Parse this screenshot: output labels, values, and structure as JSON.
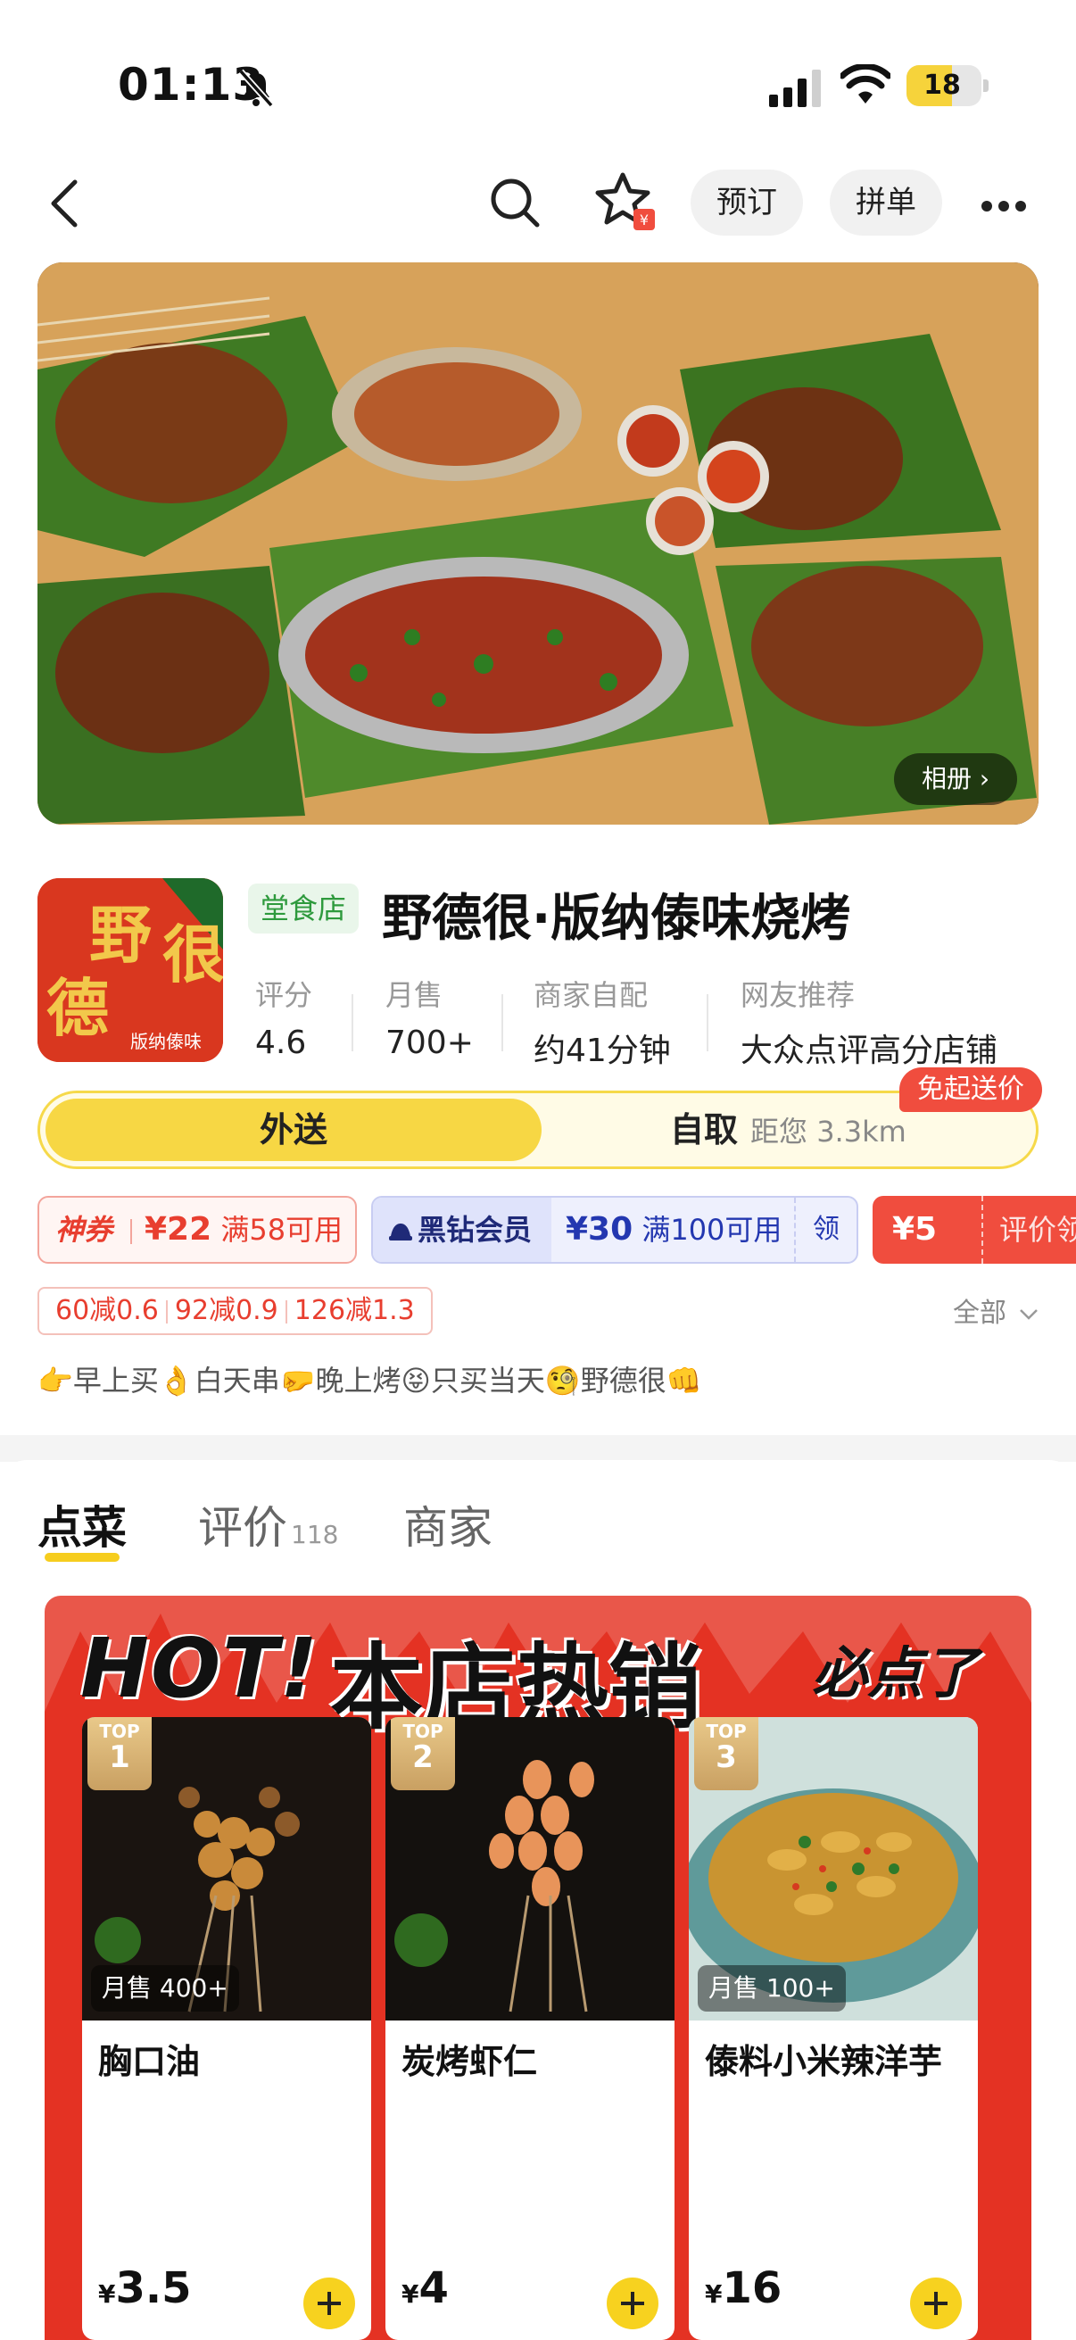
{
  "status": {
    "time": "01:13",
    "battery": "18",
    "battery_level": 0.18
  },
  "nav": {
    "book_label": "预订",
    "group_label": "拼单"
  },
  "hero": {
    "album_label": "相册 ›"
  },
  "shop": {
    "dine_tag": "堂食店",
    "name": "野德很·版纳傣味烧烤",
    "logo_text": [
      "野",
      "德",
      "很",
      "版纳傣味"
    ],
    "stats": [
      {
        "label": "评分",
        "value": "4.6"
      },
      {
        "label": "月售",
        "value": "700+"
      },
      {
        "label": "商家自配",
        "value": "约41分钟"
      },
      {
        "label": "网友推荐",
        "value": "大众点评高分店铺"
      }
    ]
  },
  "mode": {
    "delivery": "外送",
    "pickup": "自取",
    "distance": "距您 3.3km",
    "free_tag": "免起送价"
  },
  "coupons": {
    "c1_tag": "神券",
    "c1_amount": "¥22",
    "c1_cond": "满58可用",
    "c2_tag": "黑钻会员",
    "c2_amount": "¥30",
    "c2_cond": "满100可用",
    "c2_action": "领",
    "c3_amount": "¥5",
    "c3_text": "评价领"
  },
  "discounts": [
    "60减0.6",
    "92减0.9",
    "126减1.3"
  ],
  "all_label": "全部",
  "slogan": "👉早上买👌白天串🤛晚上烤😝只买当天🧐野德很👊",
  "tabs": {
    "order": "点菜",
    "reviews": "评价",
    "reviews_count": "118",
    "merchant": "商家"
  },
  "banner": {
    "hot": "HOT!",
    "title": "本店热销",
    "sig": "必点了"
  },
  "products": [
    {
      "rank_label": "TOP",
      "rank": "1",
      "sold": "月售 400+",
      "name": "胸口油",
      "currency": "¥",
      "price": "3.5"
    },
    {
      "rank_label": "TOP",
      "rank": "2",
      "sold": "",
      "name": "炭烤虾仁",
      "currency": "¥",
      "price": "4"
    },
    {
      "rank_label": "TOP",
      "rank": "3",
      "sold": "月售 100+",
      "name": "傣料小米辣洋芋",
      "currency": "¥",
      "price": "16"
    }
  ],
  "colors": {
    "accent_yellow": "#f7d744",
    "promo_red": "#f04d3e",
    "vip_blue": "#2337b0",
    "dine_green": "#2e9a3d"
  }
}
